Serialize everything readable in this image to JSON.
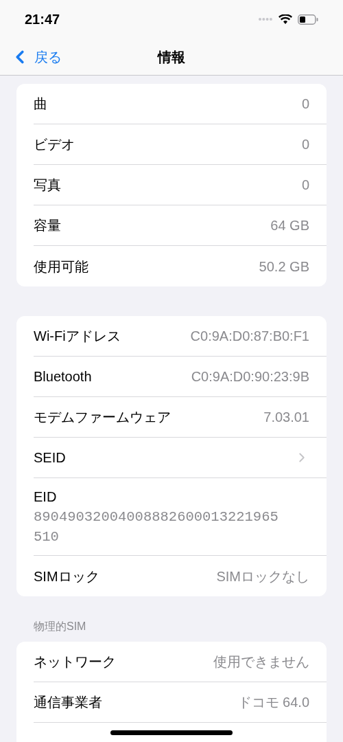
{
  "status_bar": {
    "time": "21:47"
  },
  "nav_bar": {
    "back": "戻る",
    "title": "情報"
  },
  "sections": [
    {
      "rows": [
        {
          "kind": "value",
          "label": "曲",
          "value": "0"
        },
        {
          "kind": "value",
          "label": "ビデオ",
          "value": "0"
        },
        {
          "kind": "value",
          "label": "写真",
          "value": "0"
        },
        {
          "kind": "value",
          "label": "容量",
          "value": "64 GB"
        },
        {
          "kind": "value",
          "label": "使用可能",
          "value": "50.2 GB"
        }
      ]
    },
    {
      "rows": [
        {
          "kind": "value",
          "label": "Wi-Fiアドレス",
          "value": "C0:9A:D0:87:B0:F1"
        },
        {
          "kind": "value",
          "label": "Bluetooth",
          "value": "C0:9A:D0:90:23:9B"
        },
        {
          "kind": "value",
          "label": "モデムファームウェア",
          "value": "7.03.01"
        },
        {
          "kind": "link",
          "label": "SEID"
        },
        {
          "kind": "stacked",
          "label": "EID",
          "value": "89049032004008882600013221965510"
        },
        {
          "kind": "value",
          "label": "SIMロック",
          "value": "SIMロックなし"
        }
      ]
    },
    {
      "header": "物理的SIM",
      "rows": [
        {
          "kind": "value",
          "label": "ネットワーク",
          "value": "使用できません"
        },
        {
          "kind": "value",
          "label": "通信事業者",
          "value": "ドコモ 64.0"
        }
      ]
    }
  ]
}
